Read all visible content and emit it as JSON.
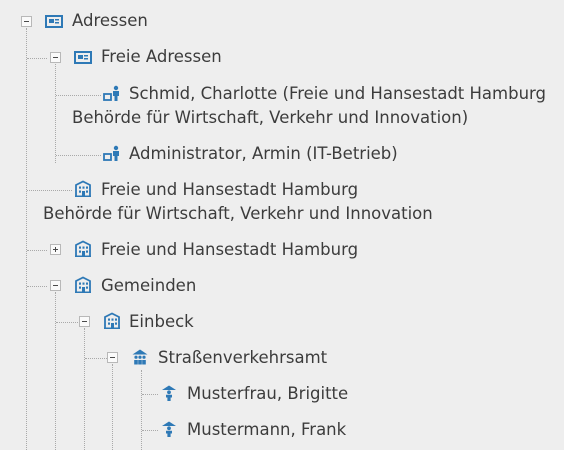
{
  "tree": {
    "root_label": "Adressen",
    "free_addresses_label": "Freie Adressen",
    "person1_line1": "Schmid, Charlotte (Freie und Hansestadt Hamburg",
    "person1_line2": "Behörde für Wirtschaft, Verkehr und Innovation)",
    "person2_label": "Administrator, Armin (IT-Betrieb)",
    "org1_line1": "Freie und Hansestadt Hamburg",
    "org1_line2": "Behörde für Wirtschaft, Verkehr und Innovation",
    "org2_label": "Freie und Hansestadt Hamburg",
    "municipalities_label": "Gemeinden",
    "einbeck_label": "Einbeck",
    "road_traffic_office_label": "Straßenverkehrsamt",
    "member1_label": "Musterfrau, Brigitte",
    "member2_label": "Mustermann, Frank"
  },
  "icons": {
    "address_book": "address-card-icon",
    "person_link": "user-link-icon",
    "building": "building-icon",
    "department": "department-icon",
    "person": "person-icon"
  },
  "colors": {
    "background": "#eeeeee",
    "icon_blue": "#2e79b6",
    "text": "#3c3c3c"
  }
}
